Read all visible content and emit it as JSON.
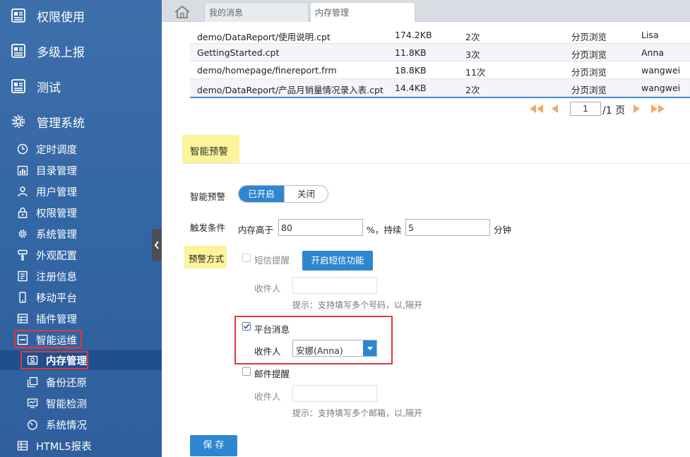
{
  "sidebar": {
    "top_items": [
      {
        "label": "权限使用",
        "icon": "report-icon"
      },
      {
        "label": "多级上报",
        "icon": "report-icon"
      },
      {
        "label": "测试",
        "icon": "report-icon"
      },
      {
        "label": "管理系统",
        "icon": "gear-icon"
      }
    ],
    "sub_items": [
      {
        "label": "定时调度",
        "icon": "clock-icon"
      },
      {
        "label": "目录管理",
        "icon": "folder-chart-icon"
      },
      {
        "label": "用户管理",
        "icon": "user-icon"
      },
      {
        "label": "权限管理",
        "icon": "lock-icon"
      },
      {
        "label": "系统管理",
        "icon": "cog-icon"
      },
      {
        "label": "外观配置",
        "icon": "brush-icon"
      },
      {
        "label": "注册信息",
        "icon": "id-card-icon"
      },
      {
        "label": "移动平台",
        "icon": "mobile-icon"
      },
      {
        "label": "插件管理",
        "icon": "plugin-grid-icon"
      },
      {
        "label": "智能运维",
        "icon": "collapse-minus-icon"
      }
    ],
    "ops_children": [
      {
        "label": "内存管理",
        "icon": "memory-icon"
      },
      {
        "label": "备份还原",
        "icon": "backup-icon"
      },
      {
        "label": "智能检测",
        "icon": "monitor-icon"
      },
      {
        "label": "系统情况",
        "icon": "gauge-icon"
      }
    ],
    "last_item": {
      "label": "HTML5报表",
      "icon": "table-icon"
    }
  },
  "tabs": [
    {
      "label": "我的消息"
    },
    {
      "label": "内存管理"
    }
  ],
  "table": {
    "rows": [
      [
        "demo/DataReport/使用说明.cpt",
        "174.2KB",
        "2次",
        "分页浏览",
        "Lisa"
      ],
      [
        "GettingStarted.cpt",
        "11.8KB",
        "3次",
        "分页浏览",
        "Anna"
      ],
      [
        "demo/homepage/finereport.frm",
        "18.8KB",
        "11次",
        "分页浏览",
        "wangwei"
      ],
      [
        "demo/DataReport/产品月销量情况录入表.cpt",
        "14.4KB",
        "2次",
        "分页浏览",
        "wangwei"
      ]
    ]
  },
  "pager": {
    "current": "1",
    "total_text": "/1 页"
  },
  "alert": {
    "section_title": "智能预警",
    "enable_label": "智能预警",
    "toggle_on": "已开启",
    "toggle_off": "关闭",
    "trigger_label": "触发条件",
    "memory_above": "内存高于",
    "memory_value": "80",
    "percent_continue": "%，持续",
    "duration_value": "5",
    "minutes": "分钟",
    "method_label": "预警方式",
    "sms_label": "短信提醒",
    "sms_button": "开启短信功能",
    "recipient_label": "收件人",
    "sms_hint": "提示：支持填写多个号码，以,隔开",
    "platform_label": "平台消息",
    "platform_recipient": "安娜(Anna)",
    "mail_label": "邮件提醒",
    "mail_hint": "提示：支持填写多个邮箱，以,隔开",
    "save_button": "保 存"
  },
  "colors": {
    "sidebar": "#3366a4",
    "accent": "#2f86d0",
    "highlight": "#fbf49a",
    "annotation_red": "#e03a3a",
    "pager_orange": "#f5a86a"
  }
}
